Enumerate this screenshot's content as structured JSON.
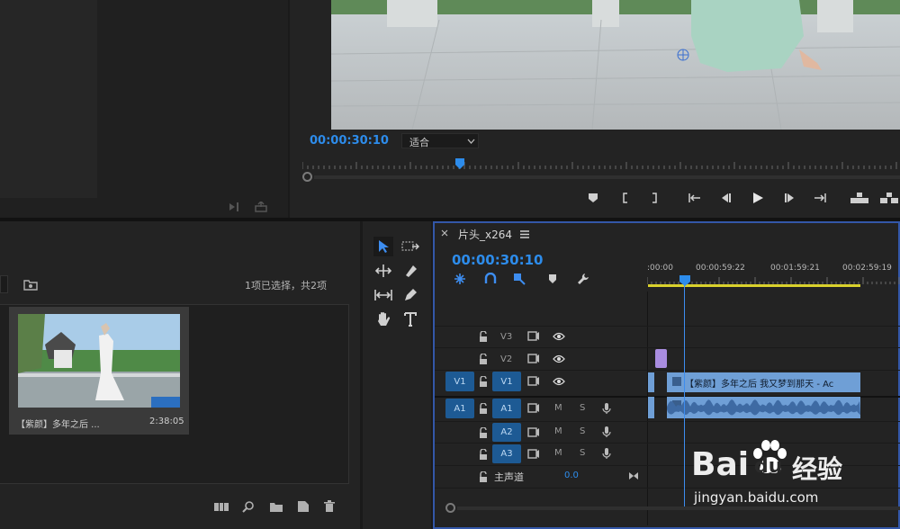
{
  "program_monitor": {
    "timecode": "00:00:30:10",
    "fit_label": "适合"
  },
  "project_panel": {
    "selection_info": "1项已选择，共2项",
    "clip_name": "【紫颜】多年之后 ...",
    "clip_duration": "2:38:05"
  },
  "timeline": {
    "tab_title": "片头_x264",
    "timecode": "00:00:30:10",
    "ruler_ticks": [
      ":00:00",
      "00:00:59:22",
      "00:01:59:21",
      "00:02:59:19"
    ],
    "tracks": {
      "v3": "V3",
      "v2": "V2",
      "v1": "V1",
      "a1": "A1",
      "a2": "A2",
      "a3": "A3",
      "src_v1": "V1",
      "src_a1": "A1",
      "master_label": "主声道",
      "master_value": "0.0"
    },
    "m_label": "M",
    "s_label": "S",
    "video_clip_label": "【紫颜】多年之后 我又梦到那天 - Ac"
  },
  "watermark": {
    "brand": "Bai",
    "brand_suffix": "du",
    "service": "经验",
    "url": "jingyan.baidu.com"
  },
  "colors": {
    "accent_blue": "#2d8ceb",
    "clip_blue": "#6f9fd6",
    "target_blue": "#1d5a94",
    "work_area_yellow": "#d9d12c",
    "purple_clip": "#a98de0"
  }
}
